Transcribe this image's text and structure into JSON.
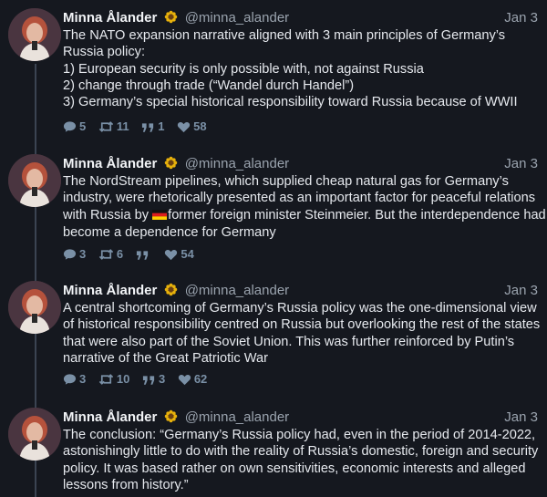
{
  "tweets": [
    {
      "author_name": "Minna Ålander",
      "author_handle": "@minna_alander",
      "date": "Jan 3",
      "lines": [
        "The NATO expansion narrative aligned with 3 main principles of Germany’s Russia policy:",
        "1) European security is only possible with, not against Russia",
        "2) change through trade (“Wandel durch Handel”)",
        "3) Germany’s special historical responsibility toward Russia because of WWII"
      ],
      "replies": "5",
      "retweets": "11",
      "quotes": "1",
      "likes": "58"
    },
    {
      "author_name": "Minna Ålander",
      "author_handle": "@minna_alander",
      "date": "Jan 3",
      "text_before_flag": "The NordStream pipelines, which supplied cheap natural gas for Germany’s industry, were rhetorically presented as an important factor for peaceful relations with Russia by ",
      "text_after_flag": "former foreign minister Steinmeier. But the interdependence had become a dependence for Germany",
      "replies": "3",
      "retweets": "6",
      "quotes": "",
      "likes": "54"
    },
    {
      "author_name": "Minna Ålander",
      "author_handle": "@minna_alander",
      "date": "Jan 3",
      "text": "A central shortcoming of Germany’s Russia policy was the one-dimensional view of historical responsibility centred on Russia but overlooking the rest of the states that were also part of the Soviet Union. This was further reinforced by Putin’s narrative of the Great Patriotic War",
      "replies": "3",
      "retweets": "10",
      "quotes": "3",
      "likes": "62"
    },
    {
      "author_name": "Minna Ålander",
      "author_handle": "@minna_alander",
      "date": "Jan 3",
      "text": "The conclusion: “Germany’s Russia policy had, even in the period of 2014-2022, astonishingly little to do with the reality of Russia’s domestic, foreign and security policy. It was based rather on own sensitivities, economic interests and alleged lessons from history.”"
    }
  ],
  "colors": {
    "background": "#15181f",
    "text": "#e6e9ee",
    "muted": "#9aa3ae",
    "action": "#7a90a6",
    "thread_line": "#3b4452"
  },
  "icons": [
    "sunflower-badge-icon",
    "german-flag-icon",
    "reply-icon",
    "retweet-icon",
    "quote-icon",
    "like-icon"
  ]
}
